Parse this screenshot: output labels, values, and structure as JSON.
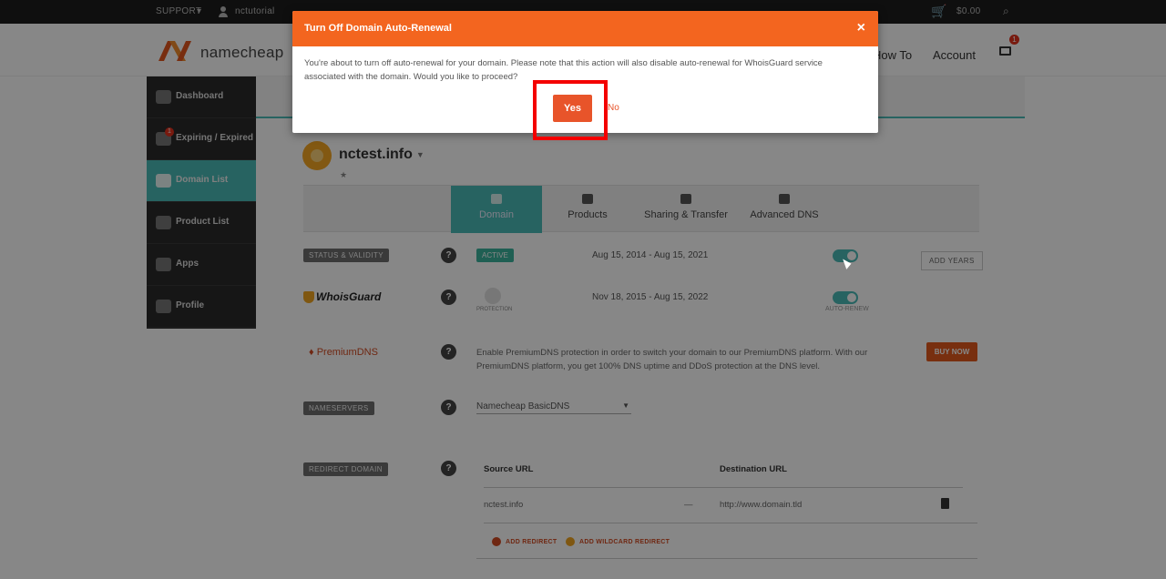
{
  "topbar": {
    "support": "SUPPORT",
    "user": "nctutorial",
    "cart": "$0.00"
  },
  "header": {
    "logo": "namecheap",
    "nav": [
      "How To",
      "Account"
    ],
    "mail_badge": "1"
  },
  "sidebar": {
    "items": [
      {
        "label": "Dashboard",
        "badge": ""
      },
      {
        "label": "Expiring / Expired",
        "badge": "1"
      },
      {
        "label": "Domain List",
        "badge": ""
      },
      {
        "label": "Product List",
        "badge": ""
      },
      {
        "label": "Apps",
        "badge": ""
      },
      {
        "label": "Profile",
        "badge": ""
      }
    ]
  },
  "domain": {
    "name": "nctest.info"
  },
  "tabs": [
    "Domain",
    "Products",
    "Sharing & Transfer",
    "Advanced DNS"
  ],
  "rows": {
    "status_label": "STATUS & VALIDITY",
    "status_badge": "ACTIVE",
    "status_dates": "Aug 15, 2014 - Aug 15, 2021",
    "add_years": "ADD YEARS",
    "whoisguard_logo": "WhoisGuard",
    "whoisguard_caption": "PROTECTION",
    "whoisguard_dates": "Nov 18, 2015 - Aug 15, 2022",
    "toggle_caption": "AUTO-RENEW",
    "premiumdns_logo": "PremiumDNS",
    "premiumdns_text": "Enable PremiumDNS protection in order to switch your domain to our PremiumDNS platform. With our PremiumDNS platform, you get 100% DNS uptime and DDoS protection at the DNS level.",
    "buy_now": "BUY NOW",
    "nameservers_label": "NAMESERVERS",
    "nameservers_value": "Namecheap BasicDNS",
    "redirect_label": "REDIRECT DOMAIN",
    "source_url_header": "Source URL",
    "destination_url_header": "Destination URL",
    "source_url": "nctest.info",
    "arrow": "—",
    "destination_url": "http://www.domain.tld",
    "add_redirect": "ADD REDIRECT",
    "add_wildcard": "ADD WILDCARD REDIRECT"
  },
  "modal": {
    "title": "Turn Off Domain Auto-Renewal",
    "close": "×",
    "body": "You're about to turn off auto-renewal for your domain. Please note that this action will also disable auto-renewal for WhoisGuard service associated with the domain. Would you like to proceed?",
    "yes": "Yes",
    "no": "No"
  },
  "colors": {
    "accent": "#f3651f",
    "teal": "#4bbcb7",
    "highlight": "#f40000"
  }
}
